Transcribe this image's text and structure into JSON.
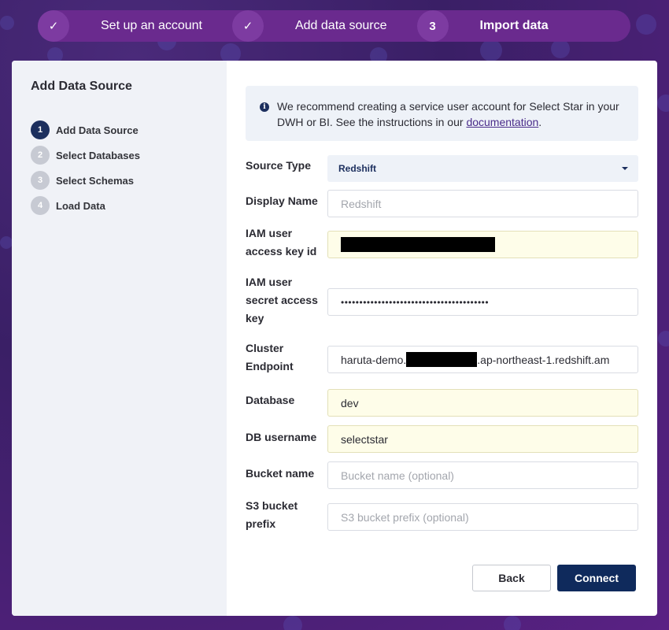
{
  "stepper": {
    "steps": [
      {
        "marker": "✓",
        "label": "Set up an account"
      },
      {
        "marker": "✓",
        "label": "Add data source"
      },
      {
        "marker": "3",
        "label": "Import data"
      }
    ]
  },
  "sidebar": {
    "title": "Add Data Source",
    "steps": [
      {
        "num": "1",
        "label": "Add Data Source"
      },
      {
        "num": "2",
        "label": "Select Databases"
      },
      {
        "num": "3",
        "label": "Select Schemas"
      },
      {
        "num": "4",
        "label": "Load Data"
      }
    ]
  },
  "info": {
    "icon": "i",
    "text": "We recommend creating a service user account for Select Star in your DWH or BI. See the instructions in our ",
    "link": "documentation",
    "suffix": "."
  },
  "form": {
    "source_type": {
      "label": "Source Type",
      "value": "Redshift"
    },
    "display_name": {
      "label": "Display Name",
      "placeholder": "Redshift"
    },
    "iam_key_id": {
      "label_1": "IAM user",
      "label_2": "access key id"
    },
    "iam_secret": {
      "label_1": "IAM user",
      "label_2": "secret access",
      "label_3": "key",
      "value": "••••••••••••••••••••••••••••••••••••••••"
    },
    "cluster_endpoint": {
      "label_1": "Cluster",
      "label_2": "Endpoint",
      "value_prefix": "haruta-demo.",
      "value_suffix": ".ap-northeast-1.redshift.am"
    },
    "database": {
      "label": "Database",
      "value": "dev"
    },
    "db_username": {
      "label": "DB username",
      "value": "selectstar"
    },
    "bucket_name": {
      "label": "Bucket name",
      "placeholder": "Bucket name (optional)"
    },
    "s3_prefix": {
      "label_1": "S3 bucket",
      "label_2": "prefix",
      "placeholder": "S3 bucket prefix (optional)"
    }
  },
  "buttons": {
    "back": "Back",
    "connect": "Connect"
  },
  "colors": {
    "primary": "#0f2a5c",
    "stepper_bg": "#6a2a8e",
    "sidebar_bg": "#f0f2f7",
    "filled_field": "#fefde9"
  }
}
